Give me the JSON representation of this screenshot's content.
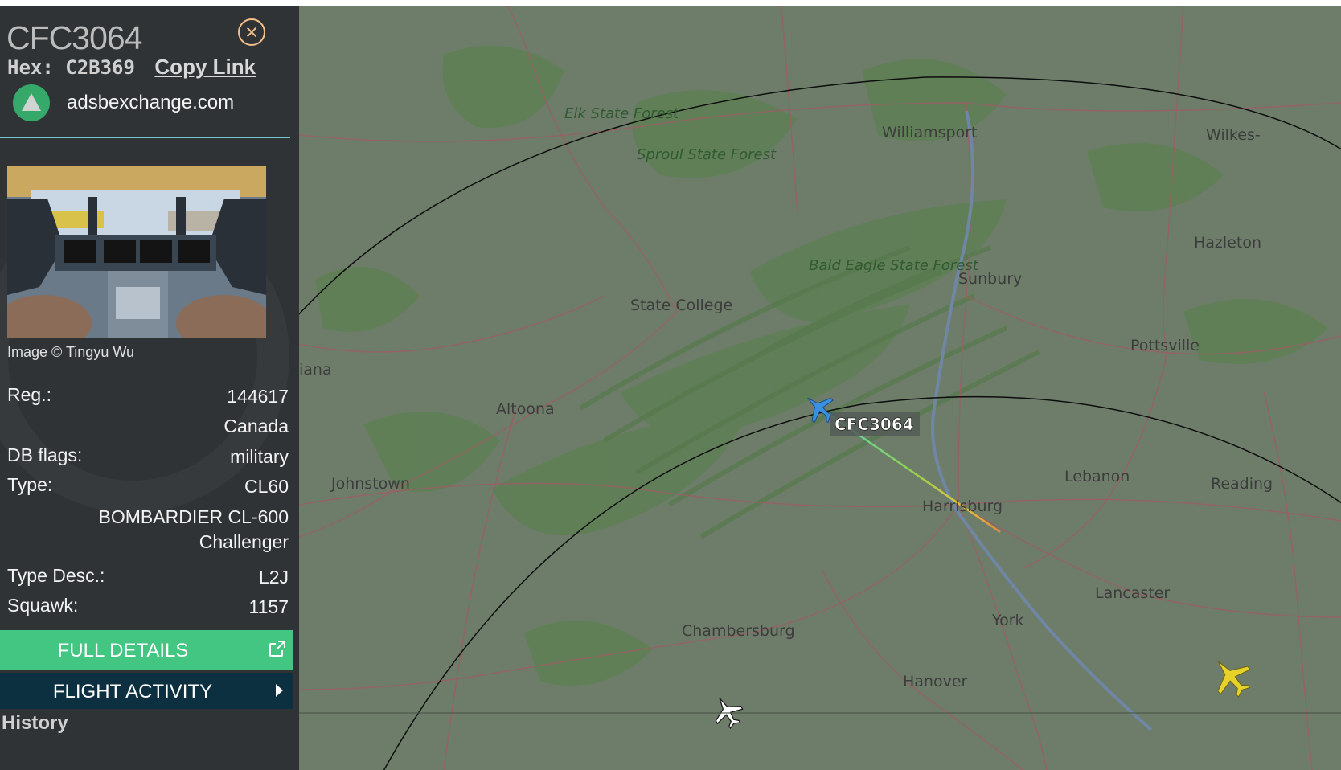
{
  "panel": {
    "callsign": "CFC3064",
    "close_icon": "close-circle-icon",
    "hex_label": "Hex:",
    "hex_value": "C2B369",
    "copy_link_label": "Copy Link",
    "source_name": "adsbexchange.com",
    "image_credit": "Image © Tingyu Wu",
    "fields": [
      {
        "label": "Reg.:",
        "value": "144617"
      },
      {
        "label": "",
        "value": "Canada"
      },
      {
        "label": "DB flags:",
        "value": "military"
      },
      {
        "label": "Type:",
        "value": "CL60"
      },
      {
        "label": "",
        "value": "BOMBARDIER CL-600 Challenger"
      },
      {
        "label": "Type Desc.:",
        "value": "L2J"
      },
      {
        "label": "Squawk:",
        "value": "1157"
      }
    ],
    "full_details_label": "FULL DETAILS",
    "flight_activity_label": "FLIGHT ACTIVITY",
    "history_label": "History"
  },
  "map": {
    "cities": [
      "Williamsport",
      "Wilkes-",
      "Hazleton",
      "Sunbury",
      "State College",
      "Pottsville",
      "Altoona",
      "Johnstown",
      "Lebanon",
      "Reading",
      "Harrisburg",
      "Lancaster",
      "York",
      "Chambersburg",
      "Hanover",
      "iana"
    ],
    "forests": [
      "Elk State Forest",
      "Sproul State Forest",
      "Bald Eagle State Forest"
    ],
    "aircraft_label": "CFC3064",
    "aircraft_icon": "airplane-icon"
  },
  "colors": {
    "sidebar_bg": "#303336",
    "accent_green": "#43c681",
    "activity_bg": "#0d3040",
    "divider": "#76c6c6",
    "aircraft_selected": "#3b8fe0",
    "aircraft_other": "#e6d22a"
  }
}
